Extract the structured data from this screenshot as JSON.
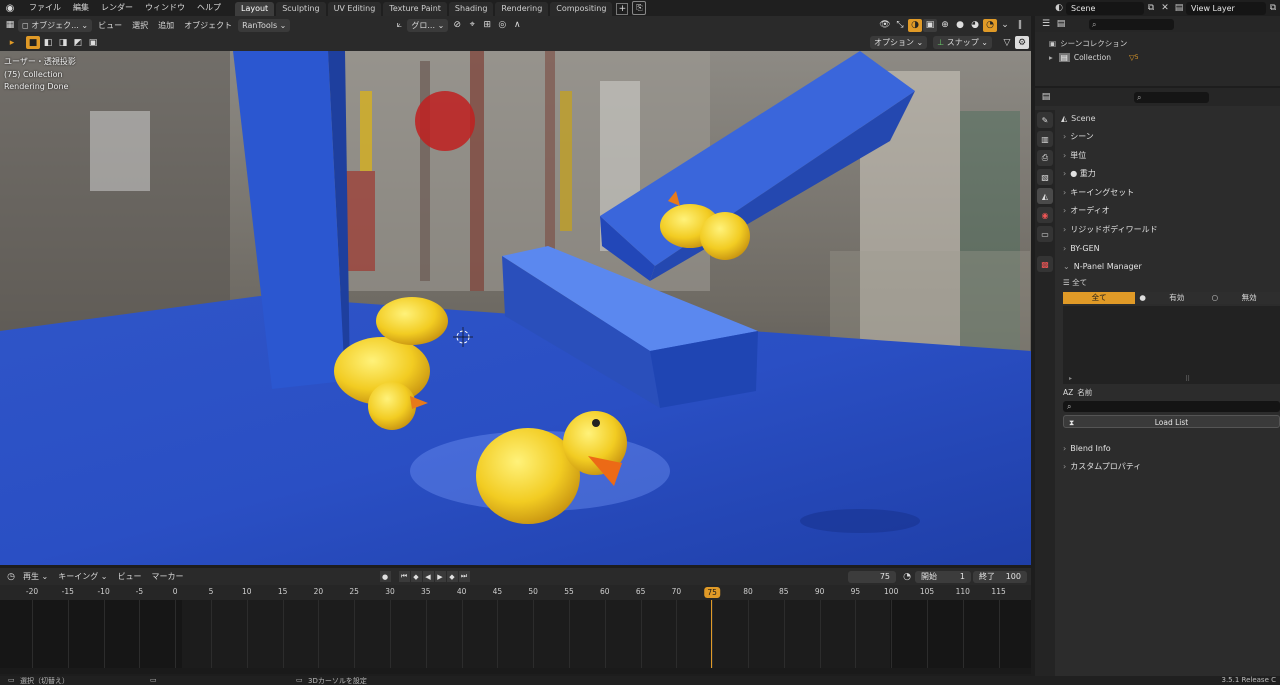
{
  "topbar": {
    "menus": [
      "ファイル",
      "編集",
      "レンダー",
      "ウィンドウ",
      "ヘルプ"
    ],
    "workspaces": [
      "Layout",
      "Sculpting",
      "UV Editing",
      "Texture Paint",
      "Shading",
      "Rendering",
      "Compositing"
    ],
    "active_workspace": "Layout",
    "scene": "Scene",
    "view_layer": "View Layer"
  },
  "viewport_header": {
    "mode": "オブジェク...",
    "menus": [
      "ビュー",
      "選択",
      "追加",
      "オブジェクト"
    ],
    "addon": "RanTools",
    "orientation": "グロ...",
    "options": "オプション",
    "snap": "スナップ"
  },
  "viewport": {
    "info_lines": [
      "ユーザー・透視投影",
      "(75) Collection",
      "Rendering Done"
    ]
  },
  "timeline": {
    "menus": [
      "再生",
      "キーイング",
      "ビュー",
      "マーカー"
    ],
    "current_frame": "75",
    "start_label": "開始",
    "start": "1",
    "end_label": "終了",
    "end": "100",
    "ticks": [
      "-20",
      "-15",
      "-10",
      "-5",
      "0",
      "5",
      "10",
      "15",
      "20",
      "25",
      "30",
      "35",
      "40",
      "45",
      "50",
      "55",
      "60",
      "65",
      "70",
      "75",
      "80",
      "85",
      "90",
      "95",
      "100",
      "105",
      "110",
      "115"
    ]
  },
  "outliner": {
    "root": "シーンコレクション",
    "collection": "Collection",
    "object_count": "5"
  },
  "properties": {
    "scene_name": "Scene",
    "sections": [
      "シーン",
      "単位",
      "重力",
      "キーイングセット",
      "オーディオ",
      "リジッドボディワールド",
      "BY-GEN"
    ],
    "npanel": {
      "title": "N-Panel Manager",
      "filter_label": "全て",
      "seg_all": "全て",
      "seg_enabled": "有効",
      "seg_disabled": "無効",
      "name_label": "名前",
      "load_list": "Load List"
    },
    "footer_sections": [
      "Blend Info",
      "カスタムプロパティ"
    ]
  },
  "statusbar": {
    "left": "選択（切替え）",
    "mid": "3Dカーソルを設定",
    "version": "3.5.1 Release C"
  }
}
